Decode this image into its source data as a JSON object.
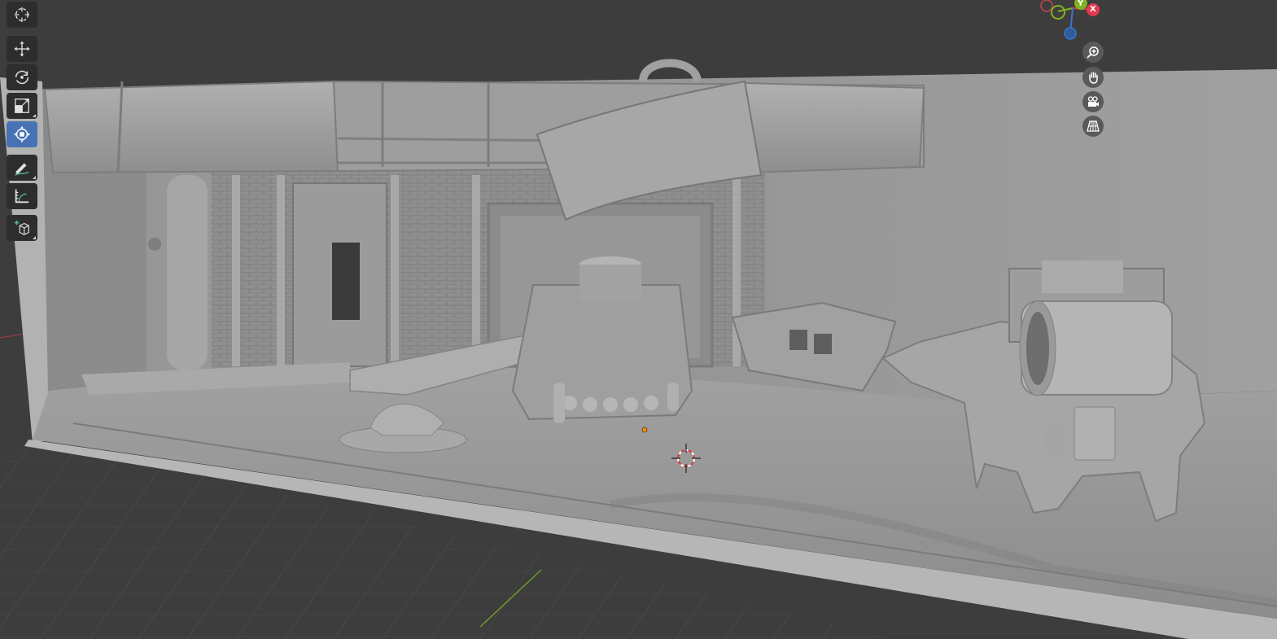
{
  "app": {
    "colors": {
      "viewport_bg": "#3d3d3d",
      "toolbar_bg": "#2d2d2d",
      "active_tool": "#4772b3",
      "x_axis": "#e0384f",
      "y_axis": "#7fb324",
      "z_axis": "#3b76c9",
      "model_gray": "#9a9a9a"
    }
  },
  "toolbar": {
    "tools": [
      {
        "name": "cursor",
        "icon": "cursor-icon",
        "active": false
      },
      {
        "name": "move",
        "icon": "move-icon",
        "active": false
      },
      {
        "name": "rotate",
        "icon": "rotate-icon",
        "active": false
      },
      {
        "name": "scale",
        "icon": "scale-icon",
        "active": false
      },
      {
        "name": "transform",
        "icon": "transform-icon",
        "active": true
      },
      {
        "name": "annotate",
        "icon": "annotate-icon",
        "active": false
      },
      {
        "name": "measure",
        "icon": "measure-icon",
        "active": false
      },
      {
        "name": "add-cube",
        "icon": "add-cube-icon",
        "active": false
      }
    ]
  },
  "gizmo": {
    "x_label": "X",
    "y_label": "Y"
  },
  "navigation": {
    "buttons": [
      "zoom-icon",
      "hand-icon",
      "camera-icon",
      "grid-icon"
    ]
  }
}
